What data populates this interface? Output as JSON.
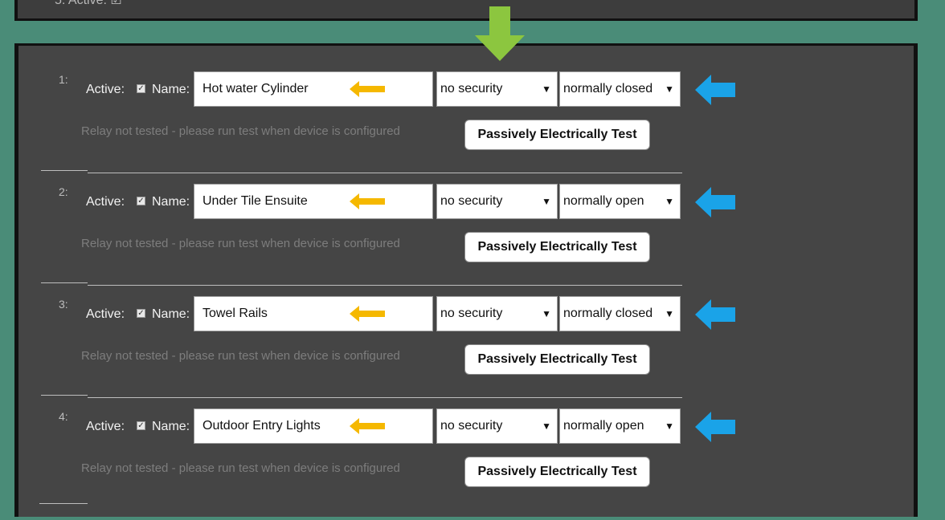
{
  "top_strip": {
    "ghost_text": "5:  Active: ☑"
  },
  "labels": {
    "active": "Active:",
    "name": "Name:",
    "status": "Relay not tested - please run test when device is configured",
    "test_button": "Passively Electrically Test"
  },
  "relays": [
    {
      "number": "1:",
      "name": "Hot water Cylinder",
      "security": "no security",
      "mode": "normally closed"
    },
    {
      "number": "2:",
      "name": "Under Tile Ensuite",
      "security": "no security",
      "mode": "normally open"
    },
    {
      "number": "3:",
      "name": "Towel Rails",
      "security": "no security",
      "mode": "normally closed"
    },
    {
      "number": "4:",
      "name": "Outdoor Entry Lights",
      "security": "no security",
      "mode": "normally open"
    }
  ],
  "colors": {
    "background": "#4a8c78",
    "panel": "#454545",
    "green_arrow": "#8cc63f",
    "yellow_arrow": "#f5b800",
    "blue_arrow": "#1aa3e8"
  }
}
